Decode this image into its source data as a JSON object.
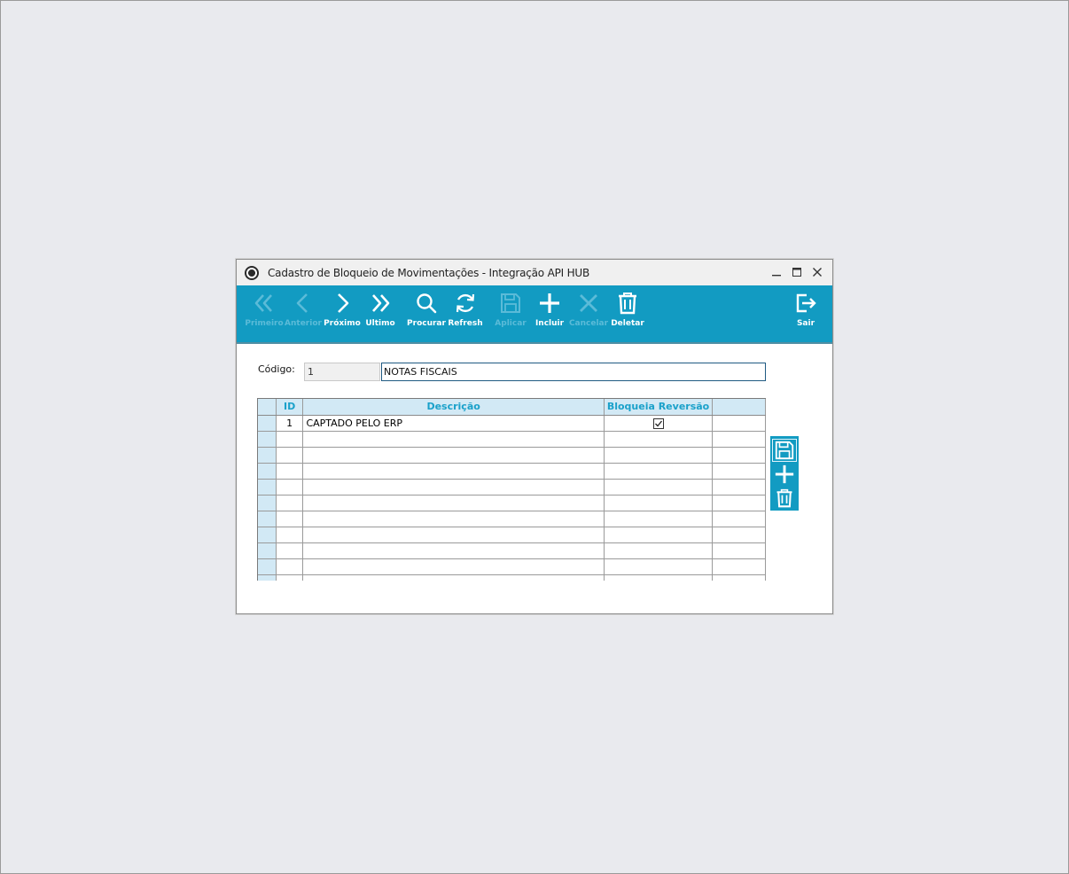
{
  "window": {
    "title": "Cadastro de Bloqueio de Movimentações - Integração API HUB"
  },
  "toolbar": {
    "buttons": [
      {
        "label": "Primeiro",
        "icon": "double-chevron-left-icon",
        "enabled": false
      },
      {
        "label": "Anterior",
        "icon": "chevron-left-icon",
        "enabled": false
      },
      {
        "label": "Próximo",
        "icon": "chevron-right-icon",
        "enabled": true
      },
      {
        "label": "Ultimo",
        "icon": "double-chevron-right-icon",
        "enabled": true
      },
      {
        "label": "Procurar",
        "icon": "search-icon",
        "enabled": true
      },
      {
        "label": "Refresh",
        "icon": "refresh-icon",
        "enabled": true
      },
      {
        "label": "Aplicar",
        "icon": "save-icon",
        "enabled": false
      },
      {
        "label": "Incluir",
        "icon": "plus-icon",
        "enabled": true
      },
      {
        "label": "Cancelar",
        "icon": "close-icon",
        "enabled": false
      },
      {
        "label": "Deletar",
        "icon": "trash-icon",
        "enabled": true
      },
      {
        "label": "Sair",
        "icon": "exit-icon",
        "enabled": true
      }
    ]
  },
  "form": {
    "codigo_label": "Código:",
    "codigo_value": "1",
    "descricao_value": "NOTAS FISCAIS"
  },
  "grid": {
    "columns": [
      "ID",
      "Descrição",
      "Bloqueia Reversão",
      ""
    ],
    "rows": [
      {
        "id": "1",
        "descricao": "CAPTADO PELO ERP",
        "bloqueia_reversao": true
      }
    ]
  },
  "side_actions": [
    {
      "icon": "save-icon",
      "active": true
    },
    {
      "icon": "plus-icon",
      "active": false
    },
    {
      "icon": "trash-icon",
      "active": false
    }
  ],
  "colors": {
    "toolbar_bg": "#129bc2",
    "header_text": "#1aa1ca",
    "header_bg": "#d2e9f5",
    "disabled_label": "#5bbbd8"
  }
}
